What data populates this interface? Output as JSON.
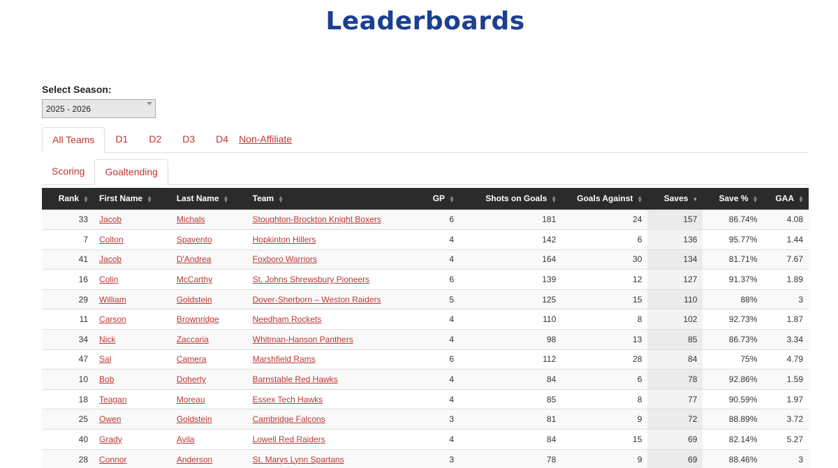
{
  "page": {
    "title": "Leaderboards"
  },
  "season": {
    "label": "Select Season:",
    "value": "2025 - 2026"
  },
  "division_tabs": [
    {
      "label": "All Teams",
      "active": true
    },
    {
      "label": "D1",
      "active": false
    },
    {
      "label": "D2",
      "active": false
    },
    {
      "label": "D3",
      "active": false
    },
    {
      "label": "D4",
      "active": false
    },
    {
      "label": "Non-Affiliate",
      "active": false
    }
  ],
  "stat_tabs": [
    {
      "label": "Scoring",
      "active": false
    },
    {
      "label": "Goaltending",
      "active": true
    }
  ],
  "table": {
    "columns": [
      "Rank",
      "First Name",
      "Last Name",
      "Team",
      "GP",
      "Shots on Goals",
      "Goals Against",
      "Saves",
      "Save %",
      "GAA"
    ],
    "sorted_column": "Saves",
    "rows": [
      [
        "33",
        "Jacob",
        "Michals",
        "Stoughton-Brockton Knight Boxers",
        "6",
        "181",
        "24",
        "157",
        "86.74%",
        "4.08"
      ],
      [
        "7",
        "Colton",
        "Spavento",
        "Hopkinton Hillers",
        "4",
        "142",
        "6",
        "136",
        "95.77%",
        "1.44"
      ],
      [
        "41",
        "Jacob",
        "D'Andrea",
        "Foxboro Warriors",
        "4",
        "164",
        "30",
        "134",
        "81.71%",
        "7.67"
      ],
      [
        "16",
        "Colin",
        "McCarthy",
        "St. Johns Shrewsbury Pioneers",
        "6",
        "139",
        "12",
        "127",
        "91.37%",
        "1.89"
      ],
      [
        "29",
        "William",
        "Goldstein",
        "Dover-Sherborn – Weston Raiders",
        "5",
        "125",
        "15",
        "110",
        "88%",
        "3"
      ],
      [
        "11",
        "Carson",
        "Brownridge",
        "Needham Rockets",
        "4",
        "110",
        "8",
        "102",
        "92.73%",
        "1.87"
      ],
      [
        "34",
        "Nick",
        "Zaccaria",
        "Whitman-Hanson Panthers",
        "4",
        "98",
        "13",
        "85",
        "86.73%",
        "3.34"
      ],
      [
        "47",
        "Sal",
        "Camera",
        "Marshfield Rams",
        "6",
        "112",
        "28",
        "84",
        "75%",
        "4.79"
      ],
      [
        "10",
        "Bob",
        "Doherty",
        "Barnstable Red Hawks",
        "4",
        "84",
        "6",
        "78",
        "92.86%",
        "1.59"
      ],
      [
        "18",
        "Teagan",
        "Moreau",
        "Essex Tech Hawks",
        "4",
        "85",
        "8",
        "77",
        "90.59%",
        "1.97"
      ],
      [
        "25",
        "Owen",
        "Goldstein",
        "Cambridge Falcons",
        "3",
        "81",
        "9",
        "72",
        "88.89%",
        "3.72"
      ],
      [
        "40",
        "Grady",
        "Avila",
        "Lowell Red Raiders",
        "4",
        "84",
        "15",
        "69",
        "82.14%",
        "5.27"
      ],
      [
        "28",
        "Connor",
        "Anderson",
        "St. Marys Lynn Spartans",
        "3",
        "78",
        "9",
        "69",
        "88.46%",
        "3"
      ]
    ]
  },
  "colors": {
    "title": "#1b3f94",
    "link": "#bf3535",
    "header_bg": "#2b2b2b"
  },
  "icons": {
    "sort": "sort-icon",
    "sort_desc": "sort-desc-icon",
    "dropdown": "chevron-down-icon"
  }
}
